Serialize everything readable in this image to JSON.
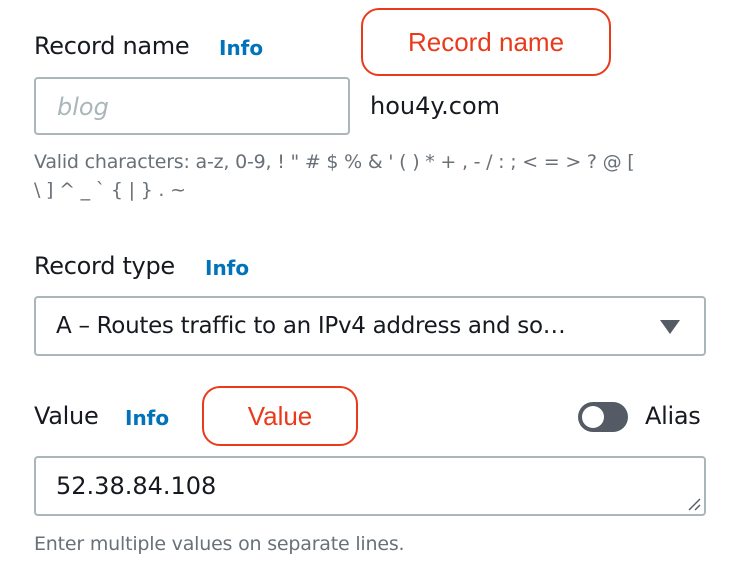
{
  "record_name": {
    "label": "Record name",
    "info_link": "Info",
    "callout": "Record name",
    "input_placeholder": "blog",
    "input_value": "",
    "domain_suffix": "hou4y.com",
    "hint_line1": "Valid characters: a-z, 0-9, ! \" # $ % & ' ( ) * + , - / : ; < = > ? @ [",
    "hint_line2": "\\ ] ^ _ ` { | } . ~"
  },
  "record_type": {
    "label": "Record type",
    "info_link": "Info",
    "selected_option": "A – Routes traffic to an IPv4 address and so…",
    "icon": "caret-down-icon"
  },
  "value": {
    "label": "Value",
    "info_link": "Info",
    "callout": "Value",
    "textarea_value": "52.38.84.108",
    "hint": "Enter multiple values on separate lines."
  },
  "alias": {
    "label": "Alias",
    "enabled": false
  },
  "colors": {
    "accent_link": "#0073bb",
    "callout_red": "#ea3a1c",
    "border_gray": "#aab7b8",
    "toggle_off": "#545b64",
    "hint_gray": "#687078"
  }
}
